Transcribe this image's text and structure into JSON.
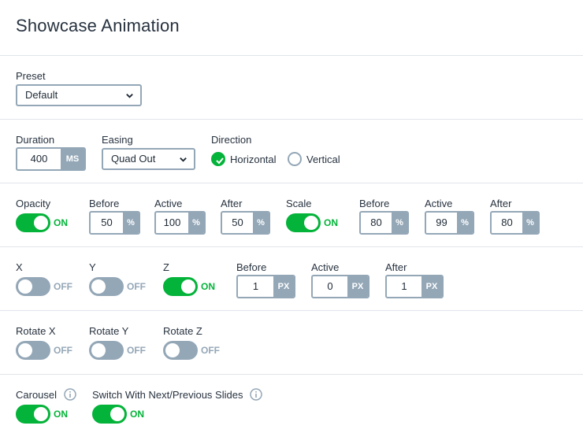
{
  "title": "Showcase Animation",
  "preset": {
    "label": "Preset",
    "value": "Default"
  },
  "duration": {
    "label": "Duration",
    "value": "400",
    "unit": "MS"
  },
  "easing": {
    "label": "Easing",
    "value": "Quad Out"
  },
  "direction": {
    "label": "Direction",
    "options": [
      {
        "label": "Horizontal",
        "checked": true
      },
      {
        "label": "Vertical",
        "checked": false
      }
    ]
  },
  "opacity": {
    "label": "Opacity",
    "state": "ON",
    "before": {
      "label": "Before",
      "value": "50",
      "unit": "%"
    },
    "active": {
      "label": "Active",
      "value": "100",
      "unit": "%"
    },
    "after": {
      "label": "After",
      "value": "50",
      "unit": "%"
    }
  },
  "scale": {
    "label": "Scale",
    "state": "ON",
    "before": {
      "label": "Before",
      "value": "80",
      "unit": "%"
    },
    "active": {
      "label": "Active",
      "value": "99",
      "unit": "%"
    },
    "after": {
      "label": "After",
      "value": "80",
      "unit": "%"
    }
  },
  "translate": {
    "x": {
      "label": "X",
      "state": "OFF"
    },
    "y": {
      "label": "Y",
      "state": "OFF"
    },
    "z": {
      "label": "Z",
      "state": "ON"
    },
    "before": {
      "label": "Before",
      "value": "1",
      "unit": "PX"
    },
    "active": {
      "label": "Active",
      "value": "0",
      "unit": "PX"
    },
    "after": {
      "label": "After",
      "value": "1",
      "unit": "PX"
    }
  },
  "rotate": {
    "x": {
      "label": "Rotate X",
      "state": "OFF"
    },
    "y": {
      "label": "Rotate Y",
      "state": "OFF"
    },
    "z": {
      "label": "Rotate Z",
      "state": "OFF"
    }
  },
  "carousel": {
    "label": "Carousel",
    "state": "ON"
  },
  "switch_slides": {
    "label": "Switch With Next/Previous Slides",
    "state": "ON"
  },
  "colors": {
    "accent": "#04b339",
    "muted": "#94a7b7",
    "text": "#27323f"
  }
}
